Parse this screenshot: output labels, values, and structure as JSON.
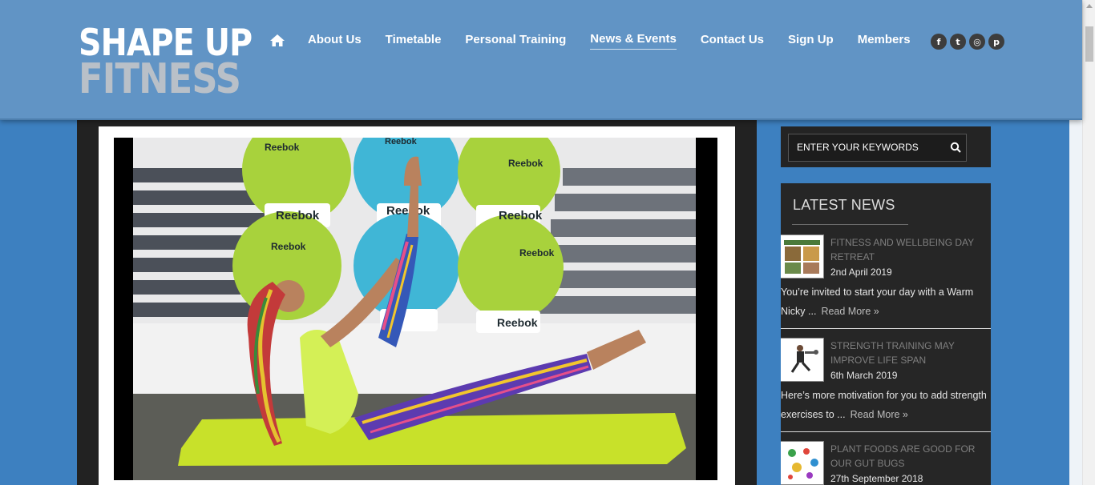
{
  "brand": {
    "line1": "SHAPE UP",
    "line2": "FITNESS"
  },
  "nav": {
    "home_icon": "home-icon",
    "items": [
      "About Us",
      "Timetable",
      "Personal Training",
      "News & Events",
      "Contact Us",
      "Sign Up",
      "Members"
    ],
    "active": "News & Events"
  },
  "social": [
    {
      "icon": "facebook-icon",
      "glyph": "f"
    },
    {
      "icon": "twitter-icon",
      "glyph": "t"
    },
    {
      "icon": "instagram-icon",
      "glyph": "◎"
    },
    {
      "icon": "pinterest-icon",
      "glyph": "p"
    }
  ],
  "search": {
    "placeholder": "ENTER YOUR KEYWORDS"
  },
  "latest_news": {
    "title": "LATEST NEWS",
    "items": [
      {
        "title": "FITNESS AND WELLBEING DAY RETREAT",
        "date": "2nd April 2019",
        "excerpt": "You’re invited to start your day with a Warm Nicky ...",
        "read_more": "Read More »"
      },
      {
        "title": "STRENGTH TRAINING MAY IMPROVE LIFE SPAN",
        "date": "6th March 2019",
        "excerpt": "Here’s more motivation for you to add strength exercises to ...",
        "read_more": "Read More »"
      },
      {
        "title": "PLANT FOODS ARE GOOD FOR OUR GUT BUGS",
        "date": "27th September 2018",
        "excerpt": "",
        "read_more": ""
      }
    ]
  },
  "photo_text": {
    "brand_label": "Reebok"
  },
  "colors": {
    "header_bg": "#6194c5",
    "page_bg": "#3d80c0",
    "sidebar_bg": "#262626",
    "mat": "#c8e12a",
    "ball_green": "#a8d23c",
    "ball_blue": "#40b6d6"
  }
}
